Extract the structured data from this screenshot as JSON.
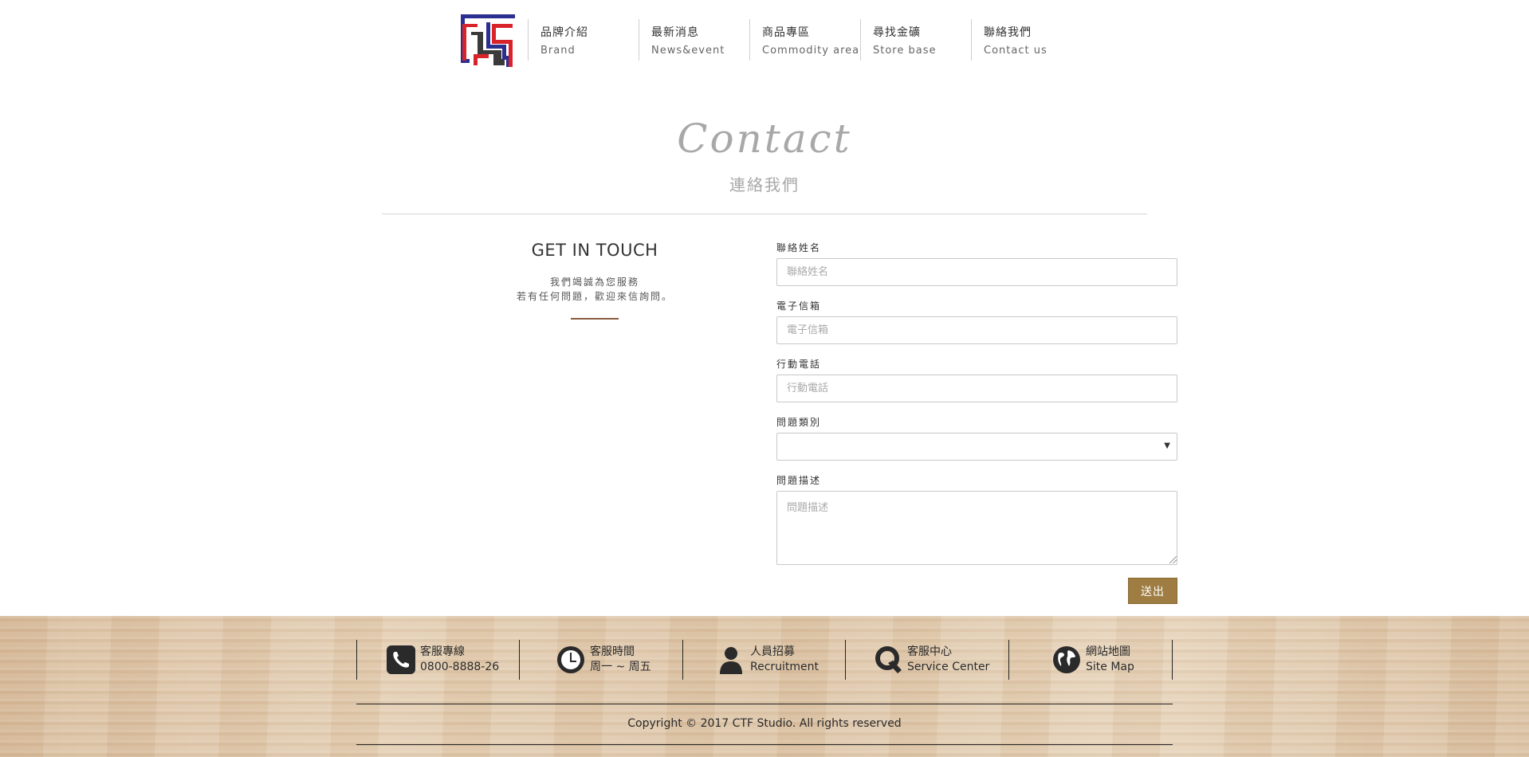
{
  "nav": {
    "items": [
      {
        "zh": "品牌介紹",
        "en": "Brand"
      },
      {
        "zh": "最新消息",
        "en": "News&event"
      },
      {
        "zh": "商品專區",
        "en": "Commodity area"
      },
      {
        "zh": "尋找金礦",
        "en": "Store base"
      },
      {
        "zh": "聯絡我們",
        "en": "Contact us"
      }
    ]
  },
  "page": {
    "title": "Contact",
    "subtitle": "連絡我們"
  },
  "intro": {
    "heading": "GET IN TOUCH",
    "line1": "我們竭誠為您服務",
    "line2": "若有任何問題，歡迎來信詢問。"
  },
  "form": {
    "name_label": "聯絡姓名",
    "name_placeholder": "聯絡姓名",
    "email_label": "電子信箱",
    "email_placeholder": "電子信箱",
    "phone_label": "行動電話",
    "phone_placeholder": "行動電話",
    "category_label": "問題類別",
    "category_value": "",
    "desc_label": "問題描述",
    "desc_placeholder": "問題描述",
    "submit_label": "送出"
  },
  "footer": {
    "items": [
      {
        "icon": "phone-icon",
        "line1": "客服專線",
        "line2": "0800-8888-26"
      },
      {
        "icon": "clock-icon",
        "line1": "客服時間",
        "line2": "周一 ~ 周五"
      },
      {
        "icon": "person-icon",
        "line1": "人員招募",
        "line2": "Recruitment"
      },
      {
        "icon": "q-icon",
        "line1": "客服中心",
        "line2": "Service Center"
      },
      {
        "icon": "globe-icon",
        "line1": "網站地圖",
        "line2": "Site Map"
      }
    ],
    "copyright": "Copyright © 2017 CTF Studio. All rights reserved"
  },
  "colors": {
    "accent": "#9e7c42",
    "underline": "#8b5a3c",
    "title_gray": "#a8a8a8"
  }
}
